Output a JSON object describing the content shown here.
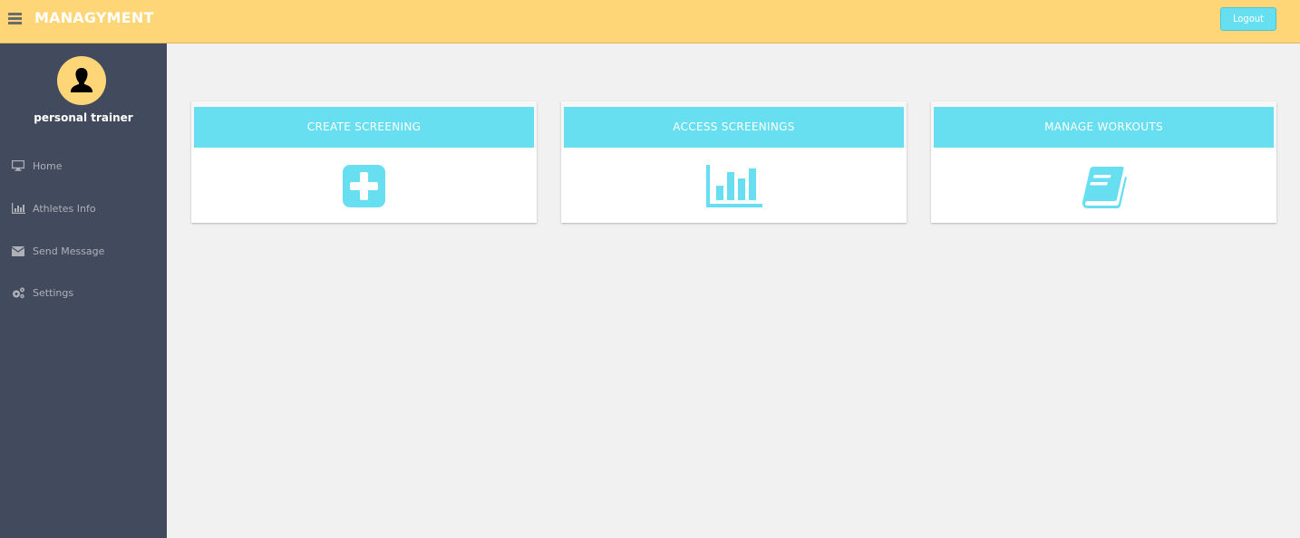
{
  "header": {
    "menu_icon": "hamburger-icon",
    "title": "MANAGYMENT",
    "logout_label": "Logout"
  },
  "sidebar": {
    "profile": {
      "avatar_icon": "user-icon",
      "name": "personal trainer"
    },
    "items": [
      {
        "icon": "desktop-icon",
        "label": "Home"
      },
      {
        "icon": "bar-chart-icon",
        "label": "Athletes Info"
      },
      {
        "icon": "envelope-icon",
        "label": "Send Message"
      },
      {
        "icon": "cogs-icon",
        "label": "Settings"
      }
    ]
  },
  "cards": [
    {
      "title": "CREATE SCREENING",
      "icon": "plus-square-icon"
    },
    {
      "title": "ACCESS SCREENINGS",
      "icon": "bar-chart-icon"
    },
    {
      "title": "MANAGE WORKOUTS",
      "icon": "book-icon"
    }
  ],
  "colors": {
    "topbar": "#ffd677",
    "sidebar": "#424a5d",
    "accent": "#68dff0",
    "background": "#f1f1f1"
  }
}
